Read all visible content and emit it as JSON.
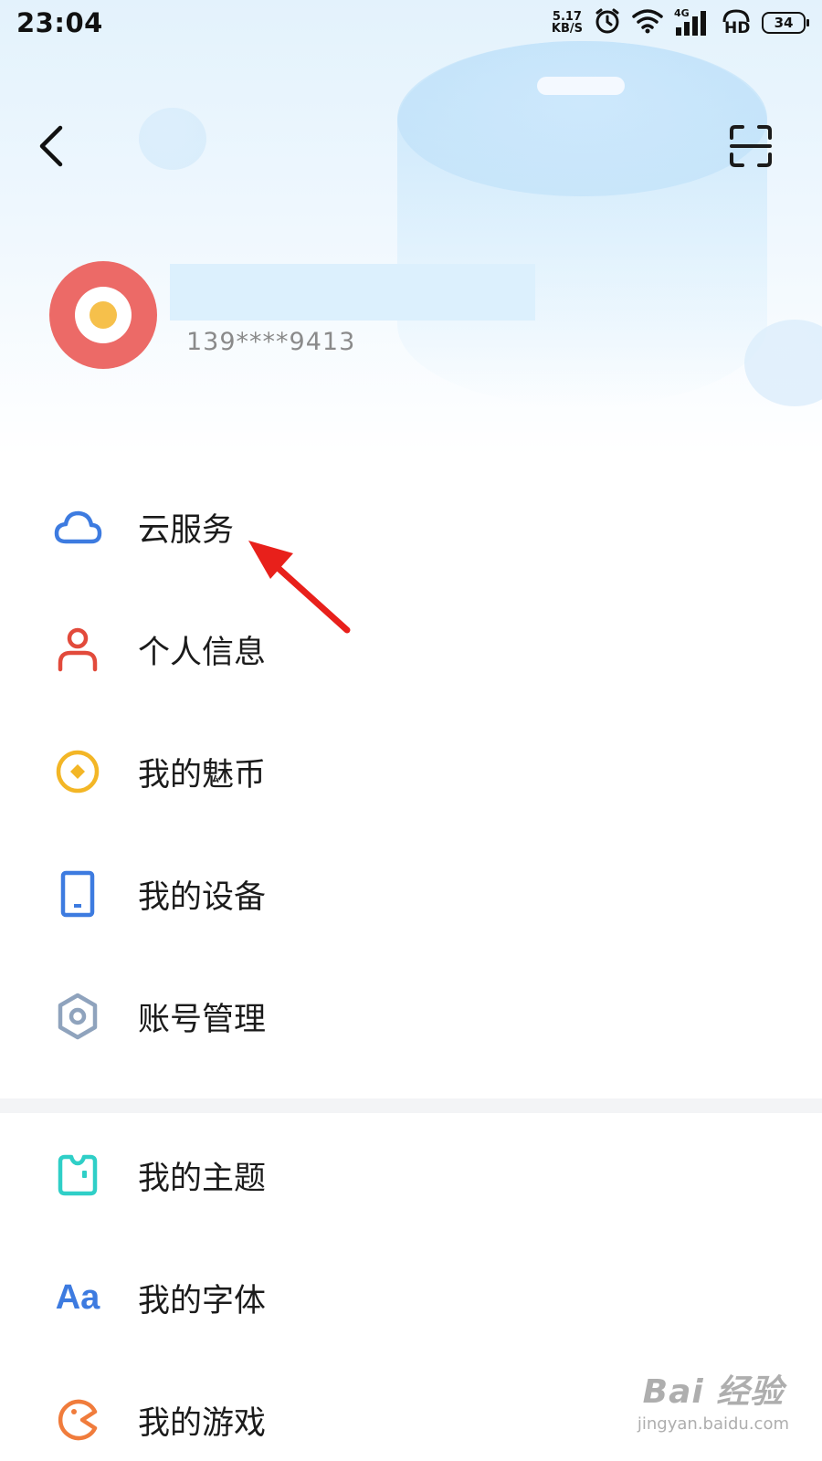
{
  "status_bar": {
    "time": "23:04",
    "net_speed_value": "5.17",
    "net_speed_unit": "KB/S",
    "signal_label": "4G",
    "hd_label": "HD",
    "battery": "34"
  },
  "profile": {
    "phone": "139****9413"
  },
  "menu_group_1": [
    {
      "label": "云服务",
      "icon": "cloud-icon"
    },
    {
      "label": "个人信息",
      "icon": "person-icon"
    },
    {
      "label": "我的魅币",
      "icon": "coin-icon"
    },
    {
      "label": "我的设备",
      "icon": "device-icon"
    },
    {
      "label": "账号管理",
      "icon": "gear-icon"
    }
  ],
  "menu_group_2": [
    {
      "label": "我的主题",
      "icon": "theme-icon"
    },
    {
      "label": "我的字体",
      "icon": "font-icon"
    },
    {
      "label": "我的游戏",
      "icon": "game-icon"
    }
  ],
  "icons": {
    "font_glyph": "Aa"
  },
  "colors": {
    "cloud": "#3d7be0",
    "person": "#e24a3b",
    "coin": "#f3b626",
    "device": "#3d7be0",
    "gear": "#8fa3bd",
    "theme": "#2fcfc7",
    "font": "#3d7be0",
    "game": "#f07c3c",
    "annotation_arrow": "#e8201b"
  },
  "watermark": {
    "logo": "Bai 经验",
    "url": "jingyan.baidu.com"
  }
}
